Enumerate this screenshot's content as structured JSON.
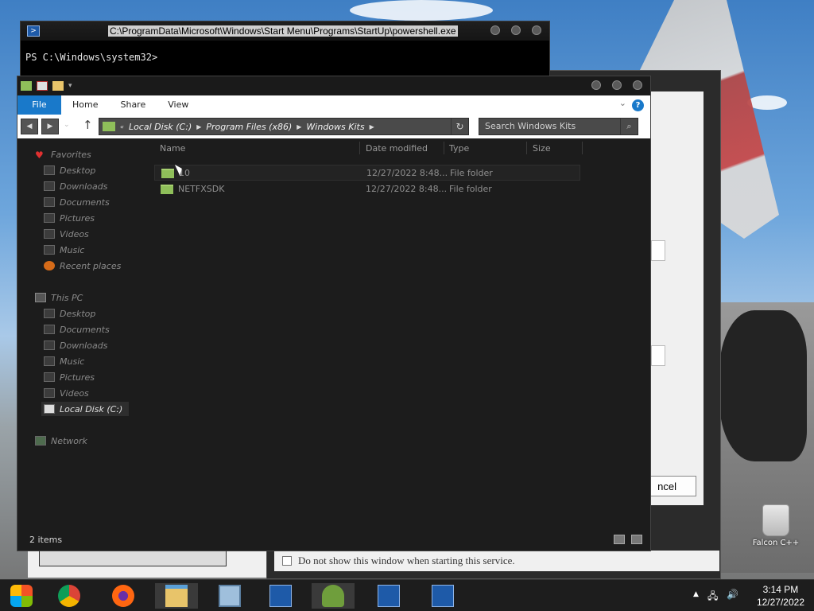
{
  "powershell": {
    "title_path": "C:\\ProgramData\\Microsoft\\Windows\\Start Menu\\Programs\\StartUp\\powershell.exe",
    "prompt": "PS C:\\Windows\\system32>"
  },
  "explorer": {
    "tabs": [
      "File",
      "Home",
      "Share",
      "View"
    ],
    "breadcrumb": [
      "Local Disk (C:)",
      "Program Files (x86)",
      "Windows Kits"
    ],
    "search_placeholder": "Search Windows Kits",
    "favorites_header": "Favorites",
    "favorites": [
      "Desktop",
      "Downloads",
      "Documents",
      "Pictures",
      "Videos",
      "Music",
      "Recent places"
    ],
    "thispc_header": "This PC",
    "thispc": [
      "Desktop",
      "Documents",
      "Downloads",
      "Music",
      "Pictures",
      "Videos",
      "Local Disk (C:)"
    ],
    "network": "Network",
    "columns": {
      "name": "Name",
      "date": "Date modified",
      "type": "Type",
      "size": "Size"
    },
    "files": [
      {
        "name": "10",
        "date": "12/27/2022 8:48...",
        "type": "File folder",
        "size": ""
      },
      {
        "name": "NETFXSDK",
        "date": "12/27/2022 8:48...",
        "type": "File folder",
        "size": ""
      }
    ],
    "status": "2 items"
  },
  "service_dialog": {
    "cancel_label": "ncel",
    "checkbox_label": "Do not show this window when starting this service."
  },
  "desktop": {
    "recycle_bin_label": "Falcon C++"
  },
  "taskbar": {
    "time": "3:14 PM",
    "date": "12/27/2022"
  }
}
